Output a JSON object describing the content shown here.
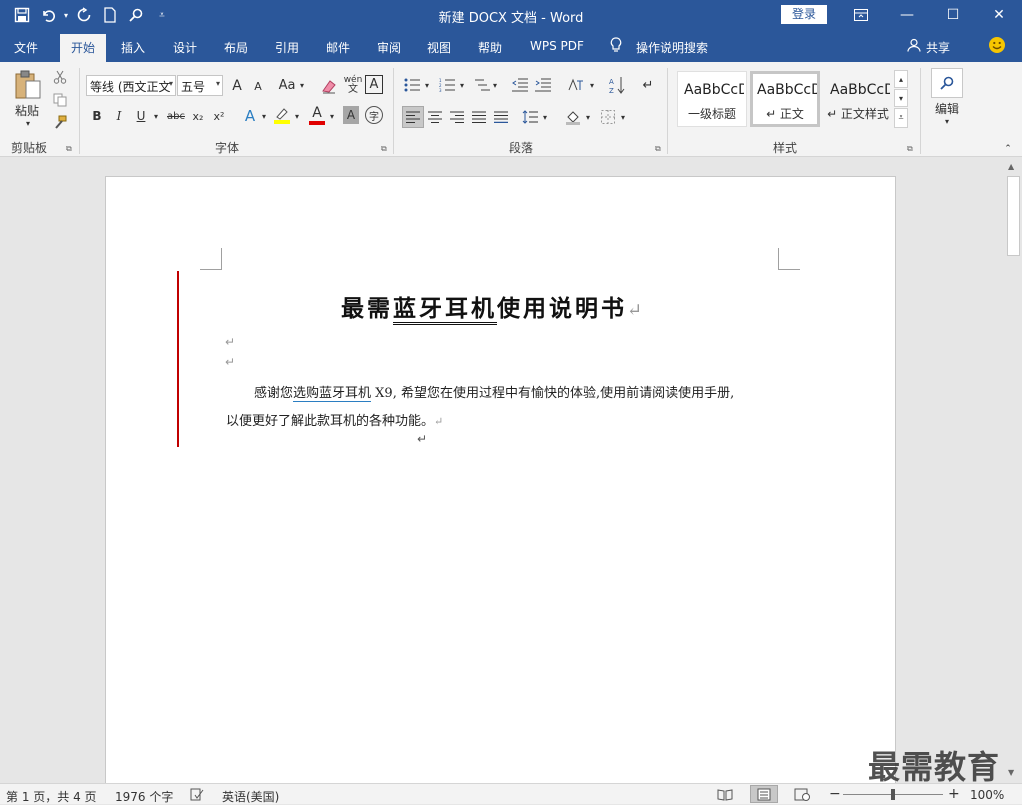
{
  "window": {
    "title": "新建 DOCX 文档  -  Word",
    "login": "登录",
    "controls": {
      "restore_icon": "ribbon-display-icon",
      "minimize": "—",
      "maximize": "☐",
      "close": "✕"
    }
  },
  "tabs": {
    "file": "文件",
    "home": "开始",
    "insert": "插入",
    "design": "设计",
    "layout": "布局",
    "references": "引用",
    "mailings": "邮件",
    "review": "审阅",
    "view": "视图",
    "help": "帮助",
    "wps_pdf": "WPS PDF",
    "tell_me": "操作说明搜索",
    "share": "共享"
  },
  "clipboard": {
    "paste": "粘贴",
    "group_label": "剪贴板"
  },
  "font": {
    "name": "等线 (西文正文",
    "size": "五号",
    "group_label": "字体",
    "grow": "A",
    "shrink": "A",
    "case": "Aa",
    "phonetic": "wén",
    "border_char": "A",
    "bold": "B",
    "italic": "I",
    "underline": "U",
    "strike": "abc",
    "subscript": "x₂",
    "superscript": "x²",
    "effects": "A",
    "font_color": "A",
    "shading": "A",
    "enclose": "字"
  },
  "paragraph": {
    "group_label": "段落"
  },
  "styles": {
    "group_label": "样式",
    "items": [
      {
        "sample": "AaBbCcD",
        "name": "一级标题"
      },
      {
        "sample": "AaBbCcDc",
        "name": "↵ 正文"
      },
      {
        "sample": "AaBbCcDc",
        "name": "↵ 正文样式"
      }
    ]
  },
  "editing": {
    "label": "编辑"
  },
  "document": {
    "title_pre": "最需",
    "title_ul": "蓝牙耳机",
    "title_post": "使用说明书",
    "body_line1_pre": "感谢您",
    "body_line1_link": "选购蓝牙耳机",
    "body_line1_post": " X9, 希望您在使用过程中有愉快的体验,使用前请阅读使用手册,",
    "body_line2": "以便更好了解此款耳机的各种功能。"
  },
  "status": {
    "page": "第 1 页，共 4 页",
    "words": "1976 个字",
    "language": "英语(美国)",
    "zoom": "100%",
    "zoom_level_percent": 100
  },
  "watermark": "最需教育",
  "colors": {
    "accent": "#2b579a",
    "red_bar": "#c00000"
  }
}
